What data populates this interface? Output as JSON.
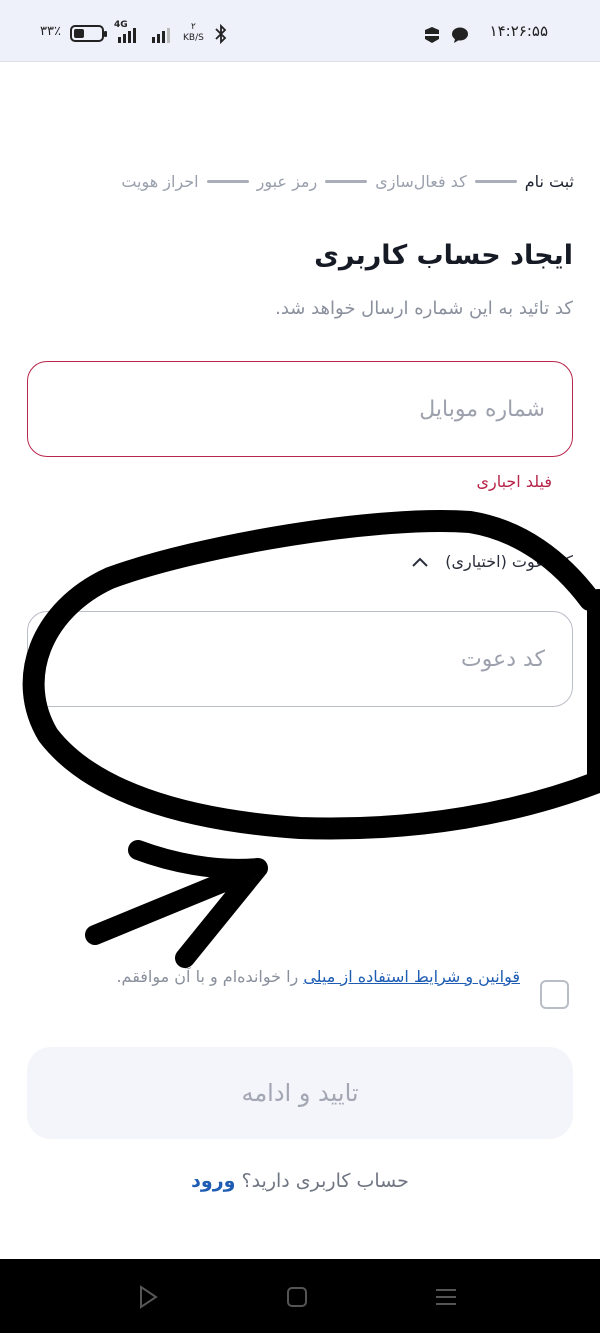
{
  "status_bar": {
    "time": "۱۴:۲۶:۵۵",
    "battery": "۳۳٪",
    "network": "4G",
    "speed_value": "۲",
    "speed_unit": "KB/S"
  },
  "stepper": {
    "steps": [
      "ثبت نام",
      "کد فعال‌سازی",
      "رمز عبور",
      "احراز هویت"
    ]
  },
  "page": {
    "title": "ایجاد حساب کاربری",
    "subtitle": "کد تائید به این شماره ارسال خواهد شد."
  },
  "mobile_field": {
    "placeholder": "شماره موبایل",
    "error": "فیلد اجباری"
  },
  "invite": {
    "toggle_label": "کد دعوت (اختیاری)",
    "placeholder": "کد دعوت"
  },
  "terms": {
    "link": "قوانین و شرایط استفاده از میلی",
    "suffix": " را خوانده‌ام و با آن موافقم."
  },
  "submit_label": "تایید و ادامه",
  "login": {
    "question": "حساب کاربری دارید؟ ",
    "link": "ورود"
  },
  "colors": {
    "error": "#b8254b",
    "link": "#1e5db3",
    "annotation_ink": "#000000"
  }
}
